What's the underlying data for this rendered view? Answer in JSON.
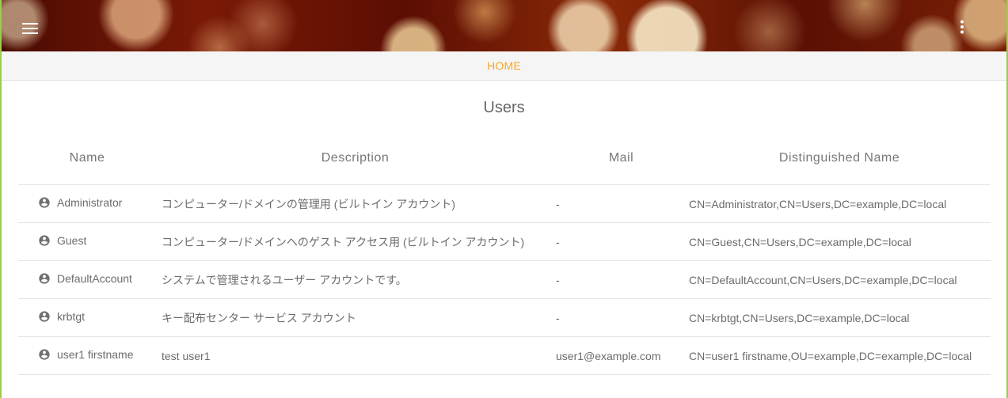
{
  "header": {
    "menu_icon": "hamburger-menu-icon",
    "more_icon": "kebab-more-icon"
  },
  "nav": {
    "home_label": "HOME",
    "accent_color": "#f7a823"
  },
  "page": {
    "title": "Users"
  },
  "table": {
    "columns": [
      "Name",
      "Description",
      "Mail",
      "Distinguished Name"
    ],
    "row_icon": "account-circle-icon",
    "rows": [
      {
        "name": "Administrator",
        "description": "コンピューター/ドメインの管理用 (ビルトイン アカウント)",
        "mail": "-",
        "dn": "CN=Administrator,CN=Users,DC=example,DC=local"
      },
      {
        "name": "Guest",
        "description": "コンピューター/ドメインへのゲスト アクセス用 (ビルトイン アカウント)",
        "mail": "-",
        "dn": "CN=Guest,CN=Users,DC=example,DC=local"
      },
      {
        "name": "DefaultAccount",
        "description": "システムで管理されるユーザー アカウントです。",
        "mail": "-",
        "dn": "CN=DefaultAccount,CN=Users,DC=example,DC=local"
      },
      {
        "name": "krbtgt",
        "description": "キー配布センター サービス アカウント",
        "mail": "-",
        "dn": "CN=krbtgt,CN=Users,DC=example,DC=local"
      },
      {
        "name": "user1 firstname",
        "description": "test user1",
        "mail": "user1@example.com",
        "dn": "CN=user1 firstname,OU=example,DC=example,DC=local"
      }
    ]
  }
}
